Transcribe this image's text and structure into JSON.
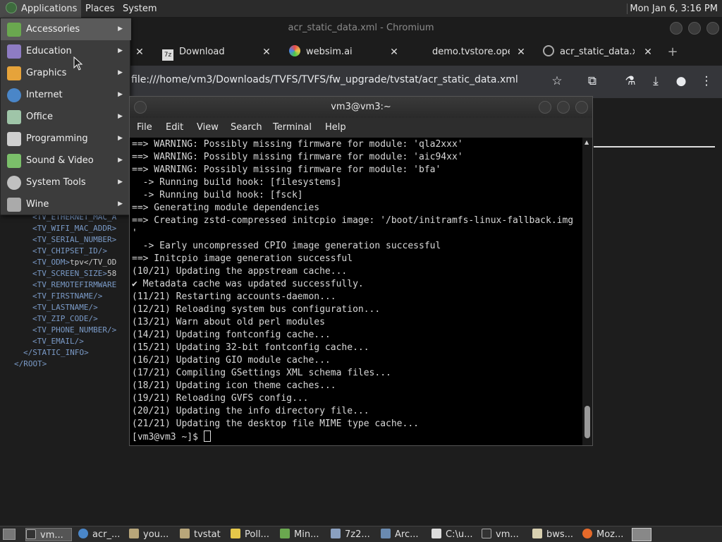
{
  "top_panel": {
    "menus": [
      "Applications",
      "Places",
      "System"
    ],
    "clock": "Mon Jan  6,  3:16 PM"
  },
  "applications_menu": {
    "items": [
      {
        "label": "Accessories",
        "icon": "accessories-icon",
        "color": "#6aa84f"
      },
      {
        "label": "Education",
        "icon": "education-icon",
        "color": "#8e7cc3"
      },
      {
        "label": "Graphics",
        "icon": "graphics-icon",
        "color": "#e6a33a"
      },
      {
        "label": "Internet",
        "icon": "internet-icon",
        "color": "#4a86c8"
      },
      {
        "label": "Office",
        "icon": "office-icon",
        "color": "#9fc5a8"
      },
      {
        "label": "Programming",
        "icon": "programming-icon",
        "color": "#cfcfcf"
      },
      {
        "label": "Sound & Video",
        "icon": "sound-video-icon",
        "color": "#7bbf6a"
      },
      {
        "label": "System Tools",
        "icon": "system-tools-icon",
        "color": "#c0c0c0"
      },
      {
        "label": "Wine",
        "icon": "wine-icon",
        "color": "#aaaaaa"
      }
    ]
  },
  "browser": {
    "window_title": "acr_static_data.xml - Chromium",
    "tabs": [
      {
        "label": "Download"
      },
      {
        "label": "websim.ai"
      },
      {
        "label": "demo.tvstore.oper"
      },
      {
        "label": "acr_static_data.xm"
      }
    ],
    "url": "file:///home/vm3/Downloads/TVFS/TVFS/fw_upgrade/tvstat/acr_static_data.xml"
  },
  "xml_view": {
    "lines": [
      {
        "text": "<TV_ETHERNET_MAC_A",
        "value": ""
      },
      {
        "text": "<TV_WIFI_MAC_ADDR>",
        "value": ""
      },
      {
        "text": "<TV_SERIAL_NUMBER>",
        "value": ""
      },
      {
        "text": "<TV_CHIPSET_ID/>",
        "value": ""
      },
      {
        "text": "<TV_ODM>",
        "value": "tpv</TV_OD"
      },
      {
        "text": "<TV_SCREEN_SIZE>",
        "value": "58"
      },
      {
        "text": "<TV_REMOTEFIRMWARE",
        "value": ""
      },
      {
        "text": "<TV_FIRSTNAME/>",
        "value": ""
      },
      {
        "text": "<TV_LASTNAME/>",
        "value": ""
      },
      {
        "text": "<TV_ZIP_CODE/>",
        "value": ""
      },
      {
        "text": "<TV_PHONE_NUMBER/>",
        "value": ""
      },
      {
        "text": "<TV_EMAIL/>",
        "value": ""
      }
    ],
    "close_static": "</STATIC_INFO>",
    "close_root": "</ROOT>"
  },
  "terminal": {
    "title": "vm3@vm3:~",
    "menus": [
      "File",
      "Edit",
      "View",
      "Search",
      "Terminal",
      "Help"
    ],
    "lines": [
      "==> WARNING: Possibly missing firmware for module: 'qla2xxx'",
      "==> WARNING: Possibly missing firmware for module: 'aic94xx'",
      "==> WARNING: Possibly missing firmware for module: 'bfa'",
      "  -> Running build hook: [filesystems]",
      "  -> Running build hook: [fsck]",
      "==> Generating module dependencies",
      "==> Creating zstd-compressed initcpio image: '/boot/initramfs-linux-fallback.img",
      "'",
      "  -> Early uncompressed CPIO image generation successful",
      "==> Initcpio image generation successful",
      "(10/21) Updating the appstream cache...",
      "✔ Metadata cache was updated successfully.",
      "(11/21) Restarting accounts-daemon...",
      "(12/21) Reloading system bus configuration...",
      "(13/21) Warn about old perl modules",
      "(14/21) Updating fontconfig cache...",
      "(15/21) Updating 32-bit fontconfig cache...",
      "(16/21) Updating GIO module cache...",
      "(17/21) Compiling GSettings XML schema files...",
      "(18/21) Updating icon theme caches...",
      "(19/21) Reloading GVFS config...",
      "(20/21) Updating the info directory file...",
      "(21/21) Updating the desktop file MIME type cache...",
      "[vm3@vm3 ~]$ "
    ]
  },
  "taskbar": {
    "items": [
      {
        "label": "vm...",
        "icon": "terminal-icon",
        "color": "#333333"
      },
      {
        "label": "acr_...",
        "icon": "chromium-icon",
        "color": "#4a86c8"
      },
      {
        "label": "you...",
        "icon": "folder-icon",
        "color": "#b8a67a"
      },
      {
        "label": "tvstat",
        "icon": "folder-icon",
        "color": "#b8a67a"
      },
      {
        "label": "Poll...",
        "icon": "poll-icon",
        "color": "#e6c84a"
      },
      {
        "label": "Min...",
        "icon": "minecraft-icon",
        "color": "#6aa84f"
      },
      {
        "label": "7z2...",
        "icon": "archive-icon",
        "color": "#8aa0c0"
      },
      {
        "label": "Arc...",
        "icon": "archive-manager-icon",
        "color": "#6a8ab0"
      },
      {
        "label": "C:\\u...",
        "icon": "wine-console-icon",
        "color": "#dddddd"
      },
      {
        "label": "vm...",
        "icon": "terminal-icon",
        "color": "#333333"
      },
      {
        "label": "bws...",
        "icon": "text-editor-icon",
        "color": "#d8d0b0"
      },
      {
        "label": "Moz...",
        "icon": "firefox-icon",
        "color": "#e66a2a"
      }
    ]
  }
}
